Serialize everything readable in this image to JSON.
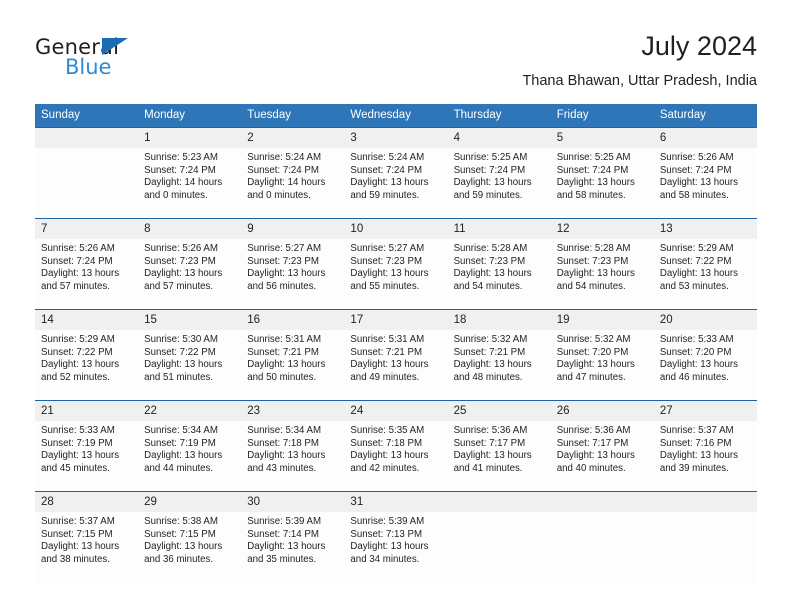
{
  "brand": {
    "name_part1": "General",
    "name_part2": "Blue",
    "triangle_icon": "triangle-icon",
    "accent_dark": "#1b6cb3",
    "accent_light": "#2e8bd4"
  },
  "header": {
    "title": "July 2024",
    "subtitle": "Thana Bhawan, Uttar Pradesh, India"
  },
  "theme": {
    "header_blue": "#2f76b8",
    "rule_blue": "#1d64a5",
    "daynum_band": "#f0f0f0",
    "text": "#231f20"
  },
  "calendar": {
    "weekdays": [
      "Sunday",
      "Monday",
      "Tuesday",
      "Wednesday",
      "Thursday",
      "Friday",
      "Saturday"
    ],
    "weeks": [
      {
        "days": [
          {
            "num": "",
            "l1": "",
            "l2": "",
            "l3": "",
            "l4": ""
          },
          {
            "num": "1",
            "l1": "Sunrise: 5:23 AM",
            "l2": "Sunset: 7:24 PM",
            "l3": "Daylight: 14 hours",
            "l4": "and 0 minutes."
          },
          {
            "num": "2",
            "l1": "Sunrise: 5:24 AM",
            "l2": "Sunset: 7:24 PM",
            "l3": "Daylight: 14 hours",
            "l4": "and 0 minutes."
          },
          {
            "num": "3",
            "l1": "Sunrise: 5:24 AM",
            "l2": "Sunset: 7:24 PM",
            "l3": "Daylight: 13 hours",
            "l4": "and 59 minutes."
          },
          {
            "num": "4",
            "l1": "Sunrise: 5:25 AM",
            "l2": "Sunset: 7:24 PM",
            "l3": "Daylight: 13 hours",
            "l4": "and 59 minutes."
          },
          {
            "num": "5",
            "l1": "Sunrise: 5:25 AM",
            "l2": "Sunset: 7:24 PM",
            "l3": "Daylight: 13 hours",
            "l4": "and 58 minutes."
          },
          {
            "num": "6",
            "l1": "Sunrise: 5:26 AM",
            "l2": "Sunset: 7:24 PM",
            "l3": "Daylight: 13 hours",
            "l4": "and 58 minutes."
          }
        ]
      },
      {
        "days": [
          {
            "num": "7",
            "l1": "Sunrise: 5:26 AM",
            "l2": "Sunset: 7:24 PM",
            "l3": "Daylight: 13 hours",
            "l4": "and 57 minutes."
          },
          {
            "num": "8",
            "l1": "Sunrise: 5:26 AM",
            "l2": "Sunset: 7:23 PM",
            "l3": "Daylight: 13 hours",
            "l4": "and 57 minutes."
          },
          {
            "num": "9",
            "l1": "Sunrise: 5:27 AM",
            "l2": "Sunset: 7:23 PM",
            "l3": "Daylight: 13 hours",
            "l4": "and 56 minutes."
          },
          {
            "num": "10",
            "l1": "Sunrise: 5:27 AM",
            "l2": "Sunset: 7:23 PM",
            "l3": "Daylight: 13 hours",
            "l4": "and 55 minutes."
          },
          {
            "num": "11",
            "l1": "Sunrise: 5:28 AM",
            "l2": "Sunset: 7:23 PM",
            "l3": "Daylight: 13 hours",
            "l4": "and 54 minutes."
          },
          {
            "num": "12",
            "l1": "Sunrise: 5:28 AM",
            "l2": "Sunset: 7:23 PM",
            "l3": "Daylight: 13 hours",
            "l4": "and 54 minutes."
          },
          {
            "num": "13",
            "l1": "Sunrise: 5:29 AM",
            "l2": "Sunset: 7:22 PM",
            "l3": "Daylight: 13 hours",
            "l4": "and 53 minutes."
          }
        ]
      },
      {
        "days": [
          {
            "num": "14",
            "l1": "Sunrise: 5:29 AM",
            "l2": "Sunset: 7:22 PM",
            "l3": "Daylight: 13 hours",
            "l4": "and 52 minutes."
          },
          {
            "num": "15",
            "l1": "Sunrise: 5:30 AM",
            "l2": "Sunset: 7:22 PM",
            "l3": "Daylight: 13 hours",
            "l4": "and 51 minutes."
          },
          {
            "num": "16",
            "l1": "Sunrise: 5:31 AM",
            "l2": "Sunset: 7:21 PM",
            "l3": "Daylight: 13 hours",
            "l4": "and 50 minutes."
          },
          {
            "num": "17",
            "l1": "Sunrise: 5:31 AM",
            "l2": "Sunset: 7:21 PM",
            "l3": "Daylight: 13 hours",
            "l4": "and 49 minutes."
          },
          {
            "num": "18",
            "l1": "Sunrise: 5:32 AM",
            "l2": "Sunset: 7:21 PM",
            "l3": "Daylight: 13 hours",
            "l4": "and 48 minutes."
          },
          {
            "num": "19",
            "l1": "Sunrise: 5:32 AM",
            "l2": "Sunset: 7:20 PM",
            "l3": "Daylight: 13 hours",
            "l4": "and 47 minutes."
          },
          {
            "num": "20",
            "l1": "Sunrise: 5:33 AM",
            "l2": "Sunset: 7:20 PM",
            "l3": "Daylight: 13 hours",
            "l4": "and 46 minutes."
          }
        ]
      },
      {
        "days": [
          {
            "num": "21",
            "l1": "Sunrise: 5:33 AM",
            "l2": "Sunset: 7:19 PM",
            "l3": "Daylight: 13 hours",
            "l4": "and 45 minutes."
          },
          {
            "num": "22",
            "l1": "Sunrise: 5:34 AM",
            "l2": "Sunset: 7:19 PM",
            "l3": "Daylight: 13 hours",
            "l4": "and 44 minutes."
          },
          {
            "num": "23",
            "l1": "Sunrise: 5:34 AM",
            "l2": "Sunset: 7:18 PM",
            "l3": "Daylight: 13 hours",
            "l4": "and 43 minutes."
          },
          {
            "num": "24",
            "l1": "Sunrise: 5:35 AM",
            "l2": "Sunset: 7:18 PM",
            "l3": "Daylight: 13 hours",
            "l4": "and 42 minutes."
          },
          {
            "num": "25",
            "l1": "Sunrise: 5:36 AM",
            "l2": "Sunset: 7:17 PM",
            "l3": "Daylight: 13 hours",
            "l4": "and 41 minutes."
          },
          {
            "num": "26",
            "l1": "Sunrise: 5:36 AM",
            "l2": "Sunset: 7:17 PM",
            "l3": "Daylight: 13 hours",
            "l4": "and 40 minutes."
          },
          {
            "num": "27",
            "l1": "Sunrise: 5:37 AM",
            "l2": "Sunset: 7:16 PM",
            "l3": "Daylight: 13 hours",
            "l4": "and 39 minutes."
          }
        ]
      },
      {
        "days": [
          {
            "num": "28",
            "l1": "Sunrise: 5:37 AM",
            "l2": "Sunset: 7:15 PM",
            "l3": "Daylight: 13 hours",
            "l4": "and 38 minutes."
          },
          {
            "num": "29",
            "l1": "Sunrise: 5:38 AM",
            "l2": "Sunset: 7:15 PM",
            "l3": "Daylight: 13 hours",
            "l4": "and 36 minutes."
          },
          {
            "num": "30",
            "l1": "Sunrise: 5:39 AM",
            "l2": "Sunset: 7:14 PM",
            "l3": "Daylight: 13 hours",
            "l4": "and 35 minutes."
          },
          {
            "num": "31",
            "l1": "Sunrise: 5:39 AM",
            "l2": "Sunset: 7:13 PM",
            "l3": "Daylight: 13 hours",
            "l4": "and 34 minutes."
          },
          {
            "num": "",
            "l1": "",
            "l2": "",
            "l3": "",
            "l4": ""
          },
          {
            "num": "",
            "l1": "",
            "l2": "",
            "l3": "",
            "l4": ""
          },
          {
            "num": "",
            "l1": "",
            "l2": "",
            "l3": "",
            "l4": ""
          }
        ]
      }
    ]
  }
}
